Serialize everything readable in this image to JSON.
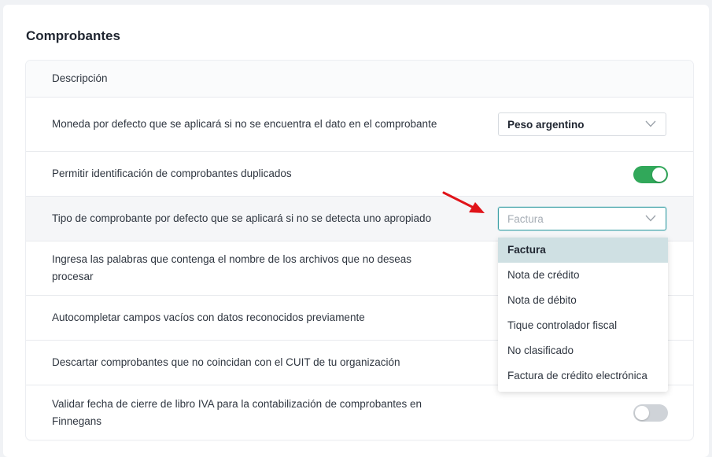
{
  "section": {
    "title": "Comprobantes"
  },
  "table": {
    "header": "Descripción",
    "rows": [
      {
        "label": "Moneda por defecto que se aplicará si no se encuentra el dato en el comprobante",
        "control": "select",
        "value": "Peso argentino"
      },
      {
        "label": "Permitir identificación de comprobantes duplicados",
        "control": "toggle",
        "state": "on"
      },
      {
        "label": "Tipo de comprobante por defecto que se aplicará si no se detecta uno apropiado",
        "control": "select",
        "value": "Factura",
        "open": true
      },
      {
        "label": "Ingresa las palabras que contenga el nombre de los archivos que no deseas procesar"
      },
      {
        "label": "Autocompletar campos vacíos con datos reconocidos previamente"
      },
      {
        "label": "Descartar comprobantes que no coincidan con el CUIT de tu organización"
      },
      {
        "label": "Validar fecha de cierre de libro IVA para la contabilización de comprobantes en Finnegans",
        "control": "toggle",
        "state": "off"
      }
    ]
  },
  "dropdown": {
    "options": [
      "Factura",
      "Nota de crédito",
      "Nota de débito",
      "Tique controlador fiscal",
      "No clasificado",
      "Factura de crédito electrónica"
    ],
    "selected_index": 0
  },
  "icons": {
    "select_caret": "chevron-down-icon",
    "annotation": "red-arrow-icon"
  },
  "colors": {
    "toggle_on": "#31a85a",
    "toggle_off": "#cfd3d8",
    "focus_border": "#3fa0a7",
    "selected_option": "#cfe0e3",
    "arrow": "#e0141a"
  }
}
